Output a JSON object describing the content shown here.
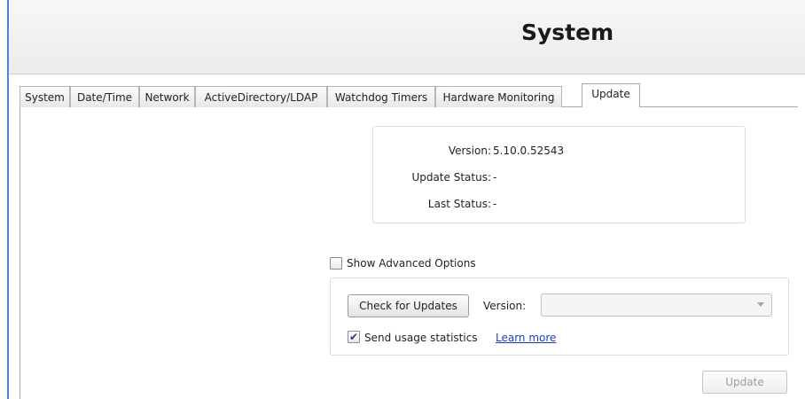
{
  "header": {
    "title": "System"
  },
  "tabs": [
    {
      "label": "System"
    },
    {
      "label": "Date/Time"
    },
    {
      "label": "Network"
    },
    {
      "label": "ActiveDirectory/LDAP"
    },
    {
      "label": "Watchdog Timers"
    },
    {
      "label": "Hardware Monitoring"
    },
    {
      "label": "Update",
      "active": true
    }
  ],
  "info": {
    "version_label": "Version:",
    "version_value": "5.10.0.52543",
    "update_status_label": "Update Status:",
    "update_status_value": "-",
    "last_status_label": "Last Status:",
    "last_status_value": "-"
  },
  "advanced": {
    "show_label": "Show Advanced Options",
    "show_checked": false,
    "check_button": "Check for Updates",
    "version_label": "Version:",
    "version_selected": "",
    "send_stats_label": "Send usage statistics",
    "send_stats_checked": true,
    "learn_more": "Learn more"
  },
  "update_button": "Update",
  "colors": {
    "accent_border": "#4a86c6",
    "link": "#1a3fc0"
  }
}
